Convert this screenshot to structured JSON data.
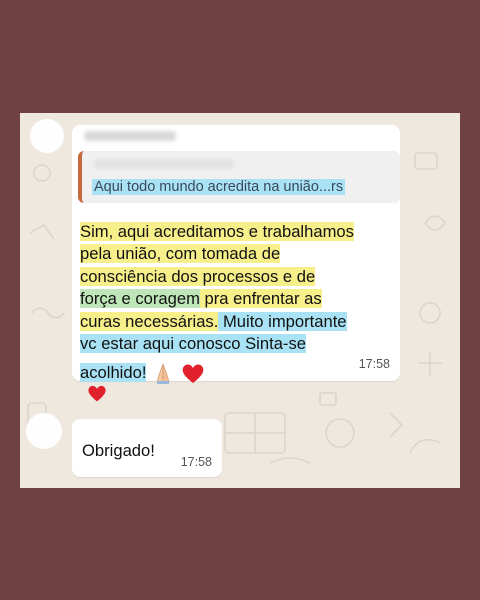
{
  "chat": {
    "message1": {
      "quote_text": "Aqui todo mundo acredita na união...rs",
      "lines": [
        "Sim, aqui acreditamos e trabalhamos",
        "pela união, com tomada de",
        "consciência dos processos e de",
        "força e coragem",
        " pra enfrentar as",
        "curas necessárias.",
        " Muito importante",
        "vc estar aqui conosco  Sinta-se",
        "acolhido!"
      ],
      "emojis": [
        "praying-hands-icon",
        "red-heart-icon"
      ],
      "time": "17:58",
      "reaction": "red-heart-icon"
    },
    "message2": {
      "text": "Obrigado!",
      "time": "17:58"
    }
  },
  "colors": {
    "frame": "#6e4240",
    "chat_background": "#eee8df",
    "highlight_yellow": "#f7ef8a",
    "highlight_green": "#bfe6b8",
    "highlight_blue": "#a9e2f4",
    "quote_bar": "#c46a3c",
    "heart": "#e0202a"
  }
}
